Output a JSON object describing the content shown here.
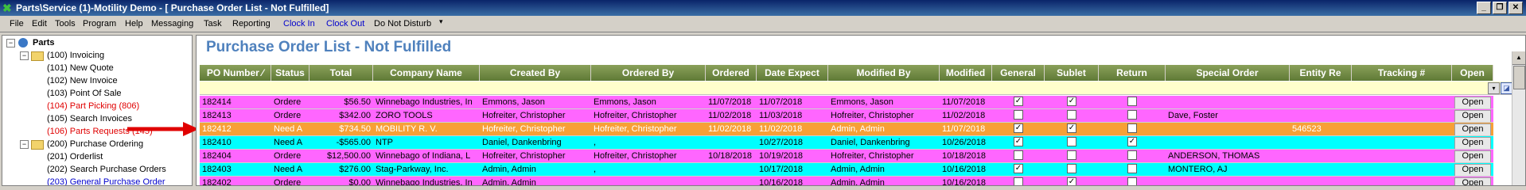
{
  "window": {
    "title": "Parts\\Service (1)-Motility Demo - [ Purchase Order List - Not Fulfilled]",
    "min_glyph": "_",
    "restore_glyph": "❐",
    "close_glyph": "✕"
  },
  "menu": {
    "items": [
      "File",
      "Edit",
      "Tools",
      "Program",
      "Help",
      "Messaging",
      "Task",
      "Reporting",
      "Clock In",
      "Clock Out",
      "Do Not Disturb"
    ],
    "dropdown_glyph": "▾"
  },
  "tree": {
    "root": "Parts",
    "invoicing": "(100) Invoicing",
    "invoicing_children": [
      "(101) New Quote",
      "(102) New Invoice",
      "(103) Point Of Sale",
      "(104) Part Picking (806)",
      "(105) Search Invoices",
      "(106) Parts Requests (145)"
    ],
    "purchase": "(200) Purchase Ordering",
    "purchase_children": [
      "(201) Orderlist",
      "(202) Search Purchase Orders",
      "(203) General Purchase Order"
    ],
    "expander_glyph": "−"
  },
  "page": {
    "title": "Purchase Order List - Not Fulfilled"
  },
  "columns": [
    "PO Number ⁄",
    "Status",
    "Total",
    "Company Name",
    "Created By",
    "Ordered By",
    "Ordered",
    "Date Expect",
    "Modified By",
    "Modified",
    "General",
    "Sublet",
    "Return",
    "Special Order",
    "Entity Re",
    "Tracking #",
    "Open"
  ],
  "filter": {
    "drop_glyph": "▾",
    "btn_glyph": "◪"
  },
  "colors": {
    "pink": "#ff66ff",
    "cyan": "#00ffff",
    "orange": "#f7a037",
    "header_green": "#6e8a3f",
    "title_blue": "#4f81bd"
  },
  "rows": [
    {
      "color": "pink",
      "po": "182414",
      "status": "Ordere",
      "total": "$56.50",
      "company": "Winnebago Industries, In",
      "created": "Emmons, Jason",
      "ordered_by": "Emmons, Jason",
      "ordered": "11/07/2018",
      "expect": "11/07/2018",
      "modified_by": "Emmons, Jason",
      "modified": "11/07/2018",
      "general": true,
      "sublet": true,
      "return": false,
      "special": "",
      "entity": "",
      "tracking": "",
      "open": "Open"
    },
    {
      "color": "pink",
      "po": "182413",
      "status": "Ordere",
      "total": "$342.00",
      "company": "ZORO TOOLS",
      "created": "Hofreiter, Christopher",
      "ordered_by": "Hofreiter, Christopher",
      "ordered": "11/02/2018",
      "expect": "11/03/2018",
      "modified_by": "Hofreiter, Christopher",
      "modified": "11/02/2018",
      "general": false,
      "sublet": false,
      "return": false,
      "special": "Dave, Foster",
      "entity": "",
      "tracking": "",
      "open": "Open"
    },
    {
      "color": "orange",
      "po": "182412",
      "status": "Need A",
      "total": "$734.50",
      "company": "MOBILITY R. V.",
      "created": "Hofreiter, Christopher",
      "ordered_by": "Hofreiter, Christopher",
      "ordered": "11/02/2018",
      "expect": "11/02/2018",
      "modified_by": "Admin, Admin",
      "modified": "11/07/2018",
      "general": true,
      "sublet": true,
      "return": false,
      "special": "",
      "entity": "546523",
      "tracking": "",
      "open": "Open"
    },
    {
      "color": "cyan",
      "po": "182410",
      "status": "Need A",
      "total": "-$565.00",
      "company": "NTP",
      "created": "Daniel, Dankenbring",
      "ordered_by": ",",
      "ordered": "",
      "expect": "10/27/2018",
      "modified_by": "Daniel, Dankenbring",
      "modified": "10/26/2018",
      "general": true,
      "sublet": false,
      "return": true,
      "special": "",
      "entity": "",
      "tracking": "",
      "open": "Open"
    },
    {
      "color": "pink",
      "po": "182404",
      "status": "Ordere",
      "total": "$12,500.00",
      "company": "Winnebago of Indiana, L",
      "created": "Hofreiter, Christopher",
      "ordered_by": "Hofreiter, Christopher",
      "ordered": "10/18/2018",
      "expect": "10/19/2018",
      "modified_by": "Hofreiter, Christopher",
      "modified": "10/18/2018",
      "general": false,
      "sublet": false,
      "return": false,
      "special": "ANDERSON, THOMAS",
      "entity": "",
      "tracking": "",
      "open": "Open"
    },
    {
      "color": "cyan",
      "po": "182403",
      "status": "Need A",
      "total": "$276.00",
      "company": "Stag-Parkway, Inc.",
      "created": "Admin, Admin",
      "ordered_by": ",",
      "ordered": "",
      "expect": "10/17/2018",
      "modified_by": "Admin, Admin",
      "modified": "10/16/2018",
      "general": true,
      "sublet": false,
      "return": false,
      "special": "MONTERO, AJ",
      "entity": "",
      "tracking": "",
      "open": "Open"
    },
    {
      "color": "pink",
      "po": "182402",
      "status": "Ordere",
      "total": "$0.00",
      "company": "Winnebago Industries, In",
      "created": "Admin, Admin",
      "ordered_by": "",
      "ordered": "",
      "expect": "10/16/2018",
      "modified_by": "Admin, Admin",
      "modified": "10/16/2018",
      "general": false,
      "sublet": true,
      "return": false,
      "special": "",
      "entity": "",
      "tracking": "",
      "open": "Open"
    }
  ],
  "scroll_up_glyph": "▲"
}
